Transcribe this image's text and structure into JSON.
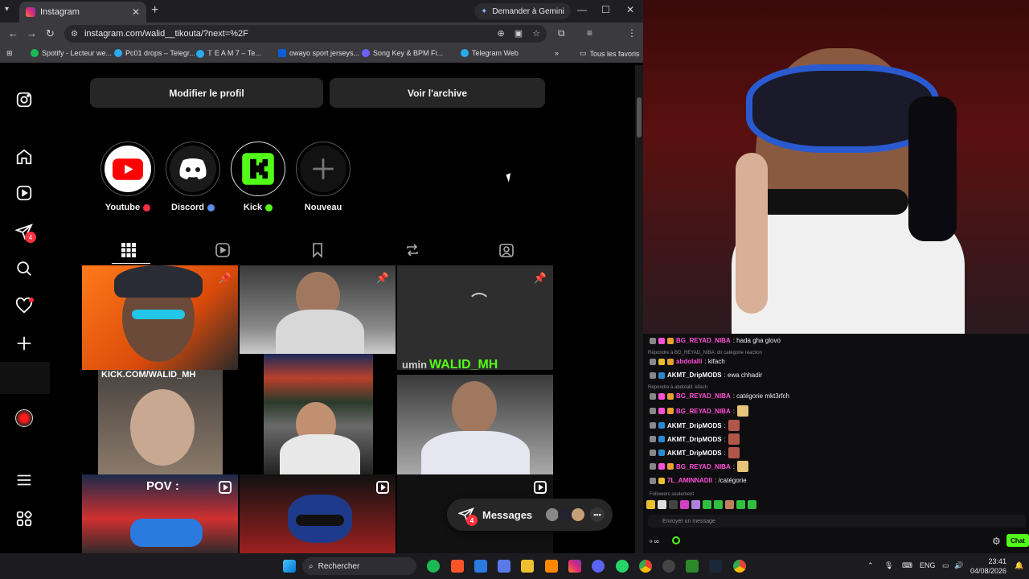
{
  "browser": {
    "tab_title": "Instagram",
    "gemini_label": "Demander à Gemini",
    "url": "instagram.com/walid__tikouta/?next=%2F",
    "bookmarks": [
      {
        "label": "Spotify - Lecteur we...",
        "color": "#1db954"
      },
      {
        "label": "Pc01 drops – Telegr...",
        "color": "#2aabee"
      },
      {
        "label": "𝕋 E A M 7 – Te...",
        "color": "#2aabee"
      },
      {
        "label": "owayo sport jerseys...",
        "color": "#0b5ed7"
      },
      {
        "label": "Song Key & BPM Fi...",
        "color": "#6c63ff"
      },
      {
        "label": "Telegram Web",
        "color": "#2aabee"
      }
    ],
    "all_bookmarks": "Tous les favoris"
  },
  "profile": {
    "edit_button": "Modifier le profil",
    "archive_button": "Voir l'archive",
    "highlights": [
      {
        "label": "Youtube",
        "dot_color": "#ff3040",
        "bg": "#ffffff",
        "icon": "youtube-icon"
      },
      {
        "label": "Discord",
        "dot_color": "#5b8def",
        "bg": "#1a1a1a",
        "icon": "discord-icon"
      },
      {
        "label": "Kick",
        "dot_color": "#53fc18",
        "bg": "#000000",
        "icon": "kick-icon"
      },
      {
        "label": "Nouveau",
        "dot_color": "",
        "bg": "#121212",
        "icon": "plus-icon"
      }
    ],
    "sidebar_badge": "4"
  },
  "grid": {
    "cell4_text": "KICK.COM/WALID_MH",
    "cell6_text": "WALID_MH",
    "cell6_partial": "umin",
    "cell7_text": "POV :"
  },
  "messages": {
    "label": "Messages",
    "badge": "4"
  },
  "chat": {
    "lines": [
      {
        "type": "msg",
        "user": "BG_REYAD_NIBA",
        "color": "#ff4fd8",
        "text": ": hada gha glovo"
      },
      {
        "type": "reply",
        "text": "Répondre à BG_REYAD_NIBA: dir catégorie réaction"
      },
      {
        "type": "msg",
        "user": "abdolalli",
        "color": "#ff4fd8",
        "text": ": kifach"
      },
      {
        "type": "msg",
        "user": "AKMT_DripMODS",
        "color": "#ffffff",
        "text": ": ewa chhadir"
      },
      {
        "type": "reply",
        "text": "Répondre à abdolalli: kifach"
      },
      {
        "type": "msg",
        "user": "BG_REYAD_NIBA",
        "color": "#ff4fd8",
        "text": ": catégorie mkt3rfch"
      },
      {
        "type": "msg",
        "user": "BG_REYAD_NIBA",
        "color": "#ff4fd8",
        "text": ":",
        "emote": "#e8c37a"
      },
      {
        "type": "msg",
        "user": "AKMT_DripMODS",
        "color": "#ffffff",
        "text": ":",
        "emote": "#b0574a"
      },
      {
        "type": "msg",
        "user": "AKMT_DripMODS",
        "color": "#ffffff",
        "text": ":",
        "emote": "#b0574a"
      },
      {
        "type": "msg",
        "user": "AKMT_DripMODS",
        "color": "#ffffff",
        "text": ":",
        "emote": "#b0574a"
      },
      {
        "type": "msg",
        "user": "BG_REYAD_NIBA",
        "color": "#ff4fd8",
        "text": ":",
        "emote": "#e8c37a"
      },
      {
        "type": "msg",
        "user": "7L_AMINNADII",
        "color": "#ff4fd8",
        "text": ": /catégorie"
      }
    ],
    "followers_only": "Followers seulement",
    "input_placeholder": "Envoyer un message",
    "chat_button": "Chat"
  },
  "taskbar": {
    "search": "Rechercher",
    "lang": "ENG",
    "time": "23:41",
    "date": "04/08/2026"
  }
}
